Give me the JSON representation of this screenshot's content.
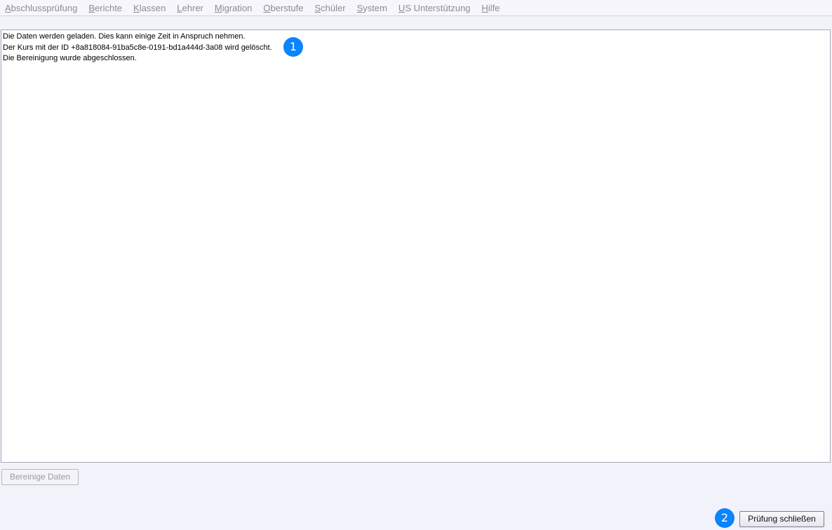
{
  "menu": {
    "items": [
      {
        "label": "Abschlussprüfung"
      },
      {
        "label": "Berichte"
      },
      {
        "label": "Klassen"
      },
      {
        "label": "Lehrer"
      },
      {
        "label": "Migration"
      },
      {
        "label": "Oberstufe"
      },
      {
        "label": "Schüler"
      },
      {
        "label": "System"
      },
      {
        "label": "US Unterstützung"
      },
      {
        "label": "Hilfe"
      }
    ]
  },
  "log": {
    "lines": [
      "Die Daten werden geladen. Dies kann einige Zeit in Anspruch nehmen.",
      "Der Kurs mit der ID +8a818084-91ba5c8e-0191-bd1a444d-3a08 wird gelöscht.",
      "Die Bereinigung wurde abgeschlossen."
    ]
  },
  "callouts": {
    "first": "1",
    "second": "2"
  },
  "buttons": {
    "clean_label": "Bereinige Daten",
    "close_label": "Prüfung schließen"
  },
  "colors": {
    "callout": "#0a84ff",
    "background": "#f2f2fb"
  }
}
